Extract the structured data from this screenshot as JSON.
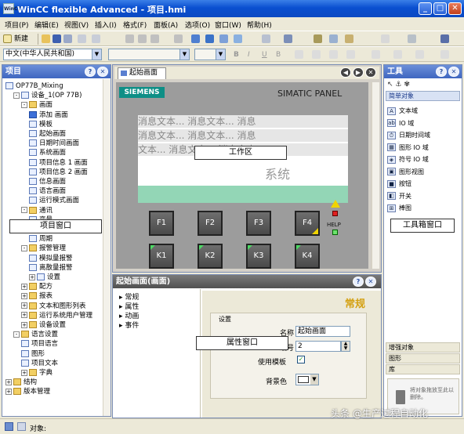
{
  "window": {
    "title": "WinCC flexible Advanced - 项目.hmi",
    "app_icon": "WinCC",
    "minimize": "_",
    "maximize": "□",
    "close": "✕"
  },
  "menu": [
    "项目(P)",
    "编辑(E)",
    "视图(V)",
    "插入(I)",
    "格式(F)",
    "面板(A)",
    "选项(O)",
    "窗口(W)",
    "帮助(H)"
  ],
  "toolbar": {
    "new_label": "新建",
    "font_combo": "中文(中华人民共和国)",
    "bold": "B",
    "italic": "I",
    "underline": "U",
    "strike": "B"
  },
  "project_panel": {
    "title": "项目",
    "help": "?",
    "close": "✕",
    "tree": [
      {
        "label": "OP77B_Mixing",
        "level": 0,
        "icon": "project",
        "exp": ""
      },
      {
        "label": "设备_1(OP 77B)",
        "level": 1,
        "icon": "device",
        "exp": "-"
      },
      {
        "label": "画面",
        "level": 2,
        "icon": "folder",
        "exp": "-"
      },
      {
        "label": "添加 画面",
        "level": 3,
        "icon": "add",
        "exp": ""
      },
      {
        "label": "模板",
        "level": 3,
        "icon": "screen",
        "exp": ""
      },
      {
        "label": "起始画面",
        "level": 3,
        "icon": "screen",
        "exp": ""
      },
      {
        "label": "日期时间画面",
        "level": 3,
        "icon": "screen",
        "exp": ""
      },
      {
        "label": "系统画面",
        "level": 3,
        "icon": "screen",
        "exp": ""
      },
      {
        "label": "项目信息 1 画面",
        "level": 3,
        "icon": "screen",
        "exp": ""
      },
      {
        "label": "项目信息 2 画面",
        "level": 3,
        "icon": "screen",
        "exp": ""
      },
      {
        "label": "信息画面",
        "level": 3,
        "icon": "screen",
        "exp": ""
      },
      {
        "label": "语言画面",
        "level": 3,
        "icon": "screen",
        "exp": ""
      },
      {
        "label": "运行模式画面",
        "level": 3,
        "icon": "screen",
        "exp": ""
      },
      {
        "label": "通讯",
        "level": 2,
        "icon": "folder",
        "exp": "-"
      },
      {
        "label": "变量",
        "level": 3,
        "icon": "screen",
        "exp": ""
      },
      {
        "label": "连接",
        "level": 3,
        "icon": "screen",
        "exp": ""
      },
      {
        "label": "周期",
        "level": 3,
        "icon": "screen",
        "exp": ""
      },
      {
        "label": "报警管理",
        "level": 2,
        "icon": "folder",
        "exp": "-"
      },
      {
        "label": "模拟量报警",
        "level": 3,
        "icon": "screen",
        "exp": ""
      },
      {
        "label": "离散量报警",
        "level": 3,
        "icon": "screen",
        "exp": ""
      },
      {
        "label": "设置",
        "level": 3,
        "icon": "screen",
        "exp": "+"
      },
      {
        "label": "配方",
        "level": 2,
        "icon": "folder",
        "exp": "+"
      },
      {
        "label": "报表",
        "level": 2,
        "icon": "folder",
        "exp": "+"
      },
      {
        "label": "文本和图形列表",
        "level": 2,
        "icon": "folder",
        "exp": "+"
      },
      {
        "label": "运行系统用户管理",
        "level": 2,
        "icon": "folder",
        "exp": "+"
      },
      {
        "label": "设备设置",
        "level": 2,
        "icon": "folder",
        "exp": "+"
      },
      {
        "label": "语言设置",
        "level": 1,
        "icon": "folder",
        "exp": "-"
      },
      {
        "label": "项目语言",
        "level": 2,
        "icon": "screen",
        "exp": ""
      },
      {
        "label": "图形",
        "level": 2,
        "icon": "screen",
        "exp": ""
      },
      {
        "label": "项目文本",
        "level": 2,
        "icon": "screen",
        "exp": ""
      },
      {
        "label": "字典",
        "level": 2,
        "icon": "folder",
        "exp": "+"
      },
      {
        "label": "结构",
        "level": 0,
        "icon": "folder",
        "exp": "+"
      },
      {
        "label": "版本管理",
        "level": 0,
        "icon": "folder",
        "exp": "+"
      }
    ],
    "callout": "项目窗口"
  },
  "editor": {
    "tab": "起始画面",
    "brand_left": "SIEMENS",
    "brand_right": "SIMATIC PANEL",
    "msg_rows": [
      "消息文本...  消息文本...  消息",
      "消息文本...  消息文本...  消息",
      "文本... 消息文本... 消息文本"
    ],
    "system_text": "系统",
    "work_callout": "工作区",
    "fkeys": [
      "F1",
      "F2",
      "F3",
      "F4"
    ],
    "kkeys": [
      "K1",
      "K2",
      "K3",
      "K4"
    ],
    "help": "HELP"
  },
  "properties": {
    "title": "起始画面(画面)",
    "nav": [
      "常规",
      "属性",
      "动画",
      "事件"
    ],
    "heading": "常规",
    "group": "设置",
    "name_label": "名称",
    "name_value": "起始画面",
    "number_label": "编号",
    "number_value": "2",
    "template_label": "使用模板",
    "bg_label": "背景色",
    "callout": "属性窗口",
    "close": "✕",
    "help": "?"
  },
  "tools": {
    "title": "工具",
    "help": "?",
    "close": "✕",
    "section": "简单对象",
    "items": [
      {
        "icon": "A",
        "label": "文本域"
      },
      {
        "icon": "ab",
        "label": "IO 域"
      },
      {
        "icon": "⏱",
        "label": "日期时间域"
      },
      {
        "icon": "▦",
        "label": "图形 IO 域"
      },
      {
        "icon": "◈",
        "label": "符号 IO 域"
      },
      {
        "icon": "▣",
        "label": "图形视图"
      },
      {
        "icon": "■",
        "label": "按钮"
      },
      {
        "icon": "◧",
        "label": "开关"
      },
      {
        "icon": "⊞",
        "label": "棒图"
      }
    ],
    "callout": "工具箱窗口",
    "sec2": "增强对象",
    "sec3": "图形",
    "sec4": "库",
    "lib_hint": "将对象拖放至此以删除。"
  },
  "status": {
    "label": "对象:"
  },
  "watermark": "头条 @生产过程自动化"
}
